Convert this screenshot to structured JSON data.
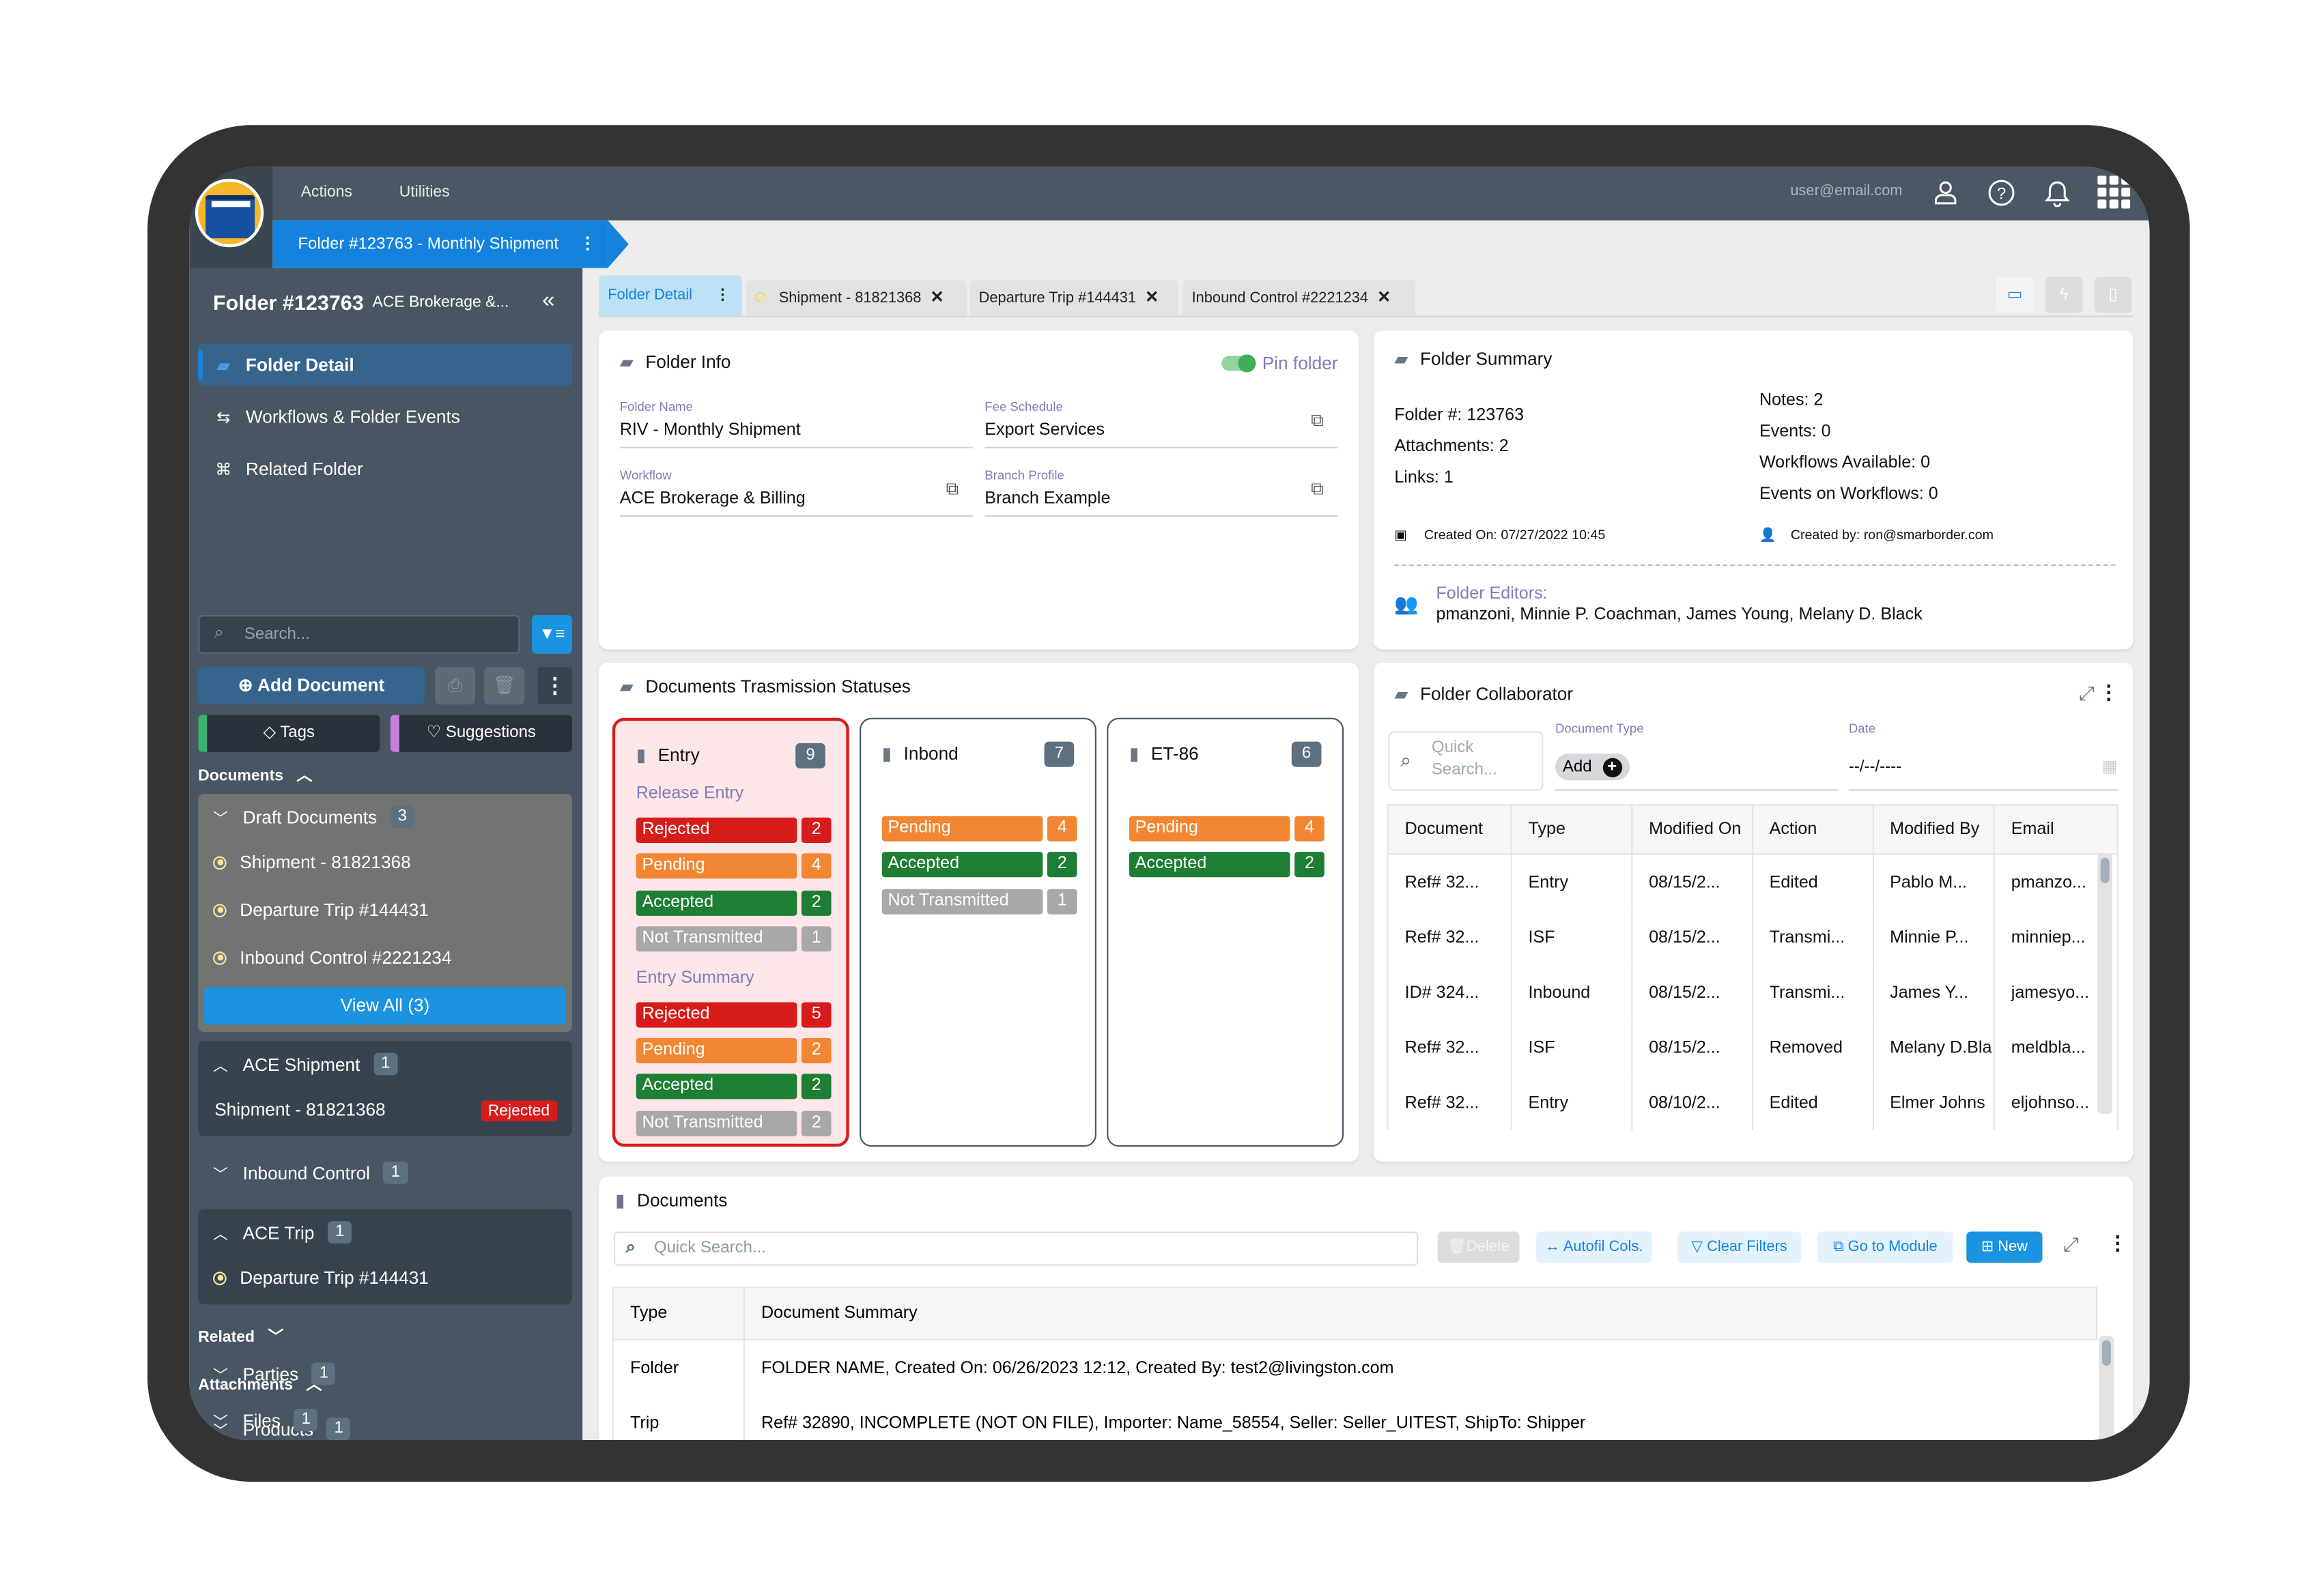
{
  "topbar": {
    "menus": [
      "Actions",
      "Utilities"
    ],
    "user_email": "user@email.com",
    "breadcrumb": "Folder #123763 - Monthly Shipment"
  },
  "sidebar": {
    "title": "Folder #123763",
    "subtitle": "ACE Brokerage &...",
    "nav": [
      {
        "label": "Folder Detail",
        "icon": "folder-open-icon",
        "active": true
      },
      {
        "label": "Workflows & Folder Events",
        "icon": "workflow-icon"
      },
      {
        "label": "Related Folder",
        "icon": "hierarchy-icon"
      }
    ],
    "search_placeholder": "Search...",
    "add_document": "Add Document",
    "tags": "Tags",
    "suggestions": "Suggestions",
    "documents_heading": "Documents",
    "draft": {
      "label": "Draft Documents",
      "count": "3",
      "items": [
        "Shipment - 81821368",
        "Departure Trip #144431",
        "Inbound Control #2221234"
      ],
      "view_all": "View All (3)"
    },
    "ace_shipment": {
      "label": "ACE Shipment",
      "count": "1",
      "item": "Shipment - 81821368",
      "status": "Rejected"
    },
    "inbound_control": {
      "label": "Inbound Control",
      "count": "1"
    },
    "ace_trip": {
      "label": "ACE Trip",
      "count": "1",
      "item": "Departure Trip #144431"
    },
    "related_heading": "Related",
    "parties": {
      "label": "Parties",
      "count": "1"
    },
    "products": {
      "label": "Products",
      "count": "1"
    },
    "attachments_heading": "Attachments",
    "files": {
      "label": "Files",
      "count": "1"
    }
  },
  "tabs": [
    {
      "label": "Folder Detail",
      "active": true
    },
    {
      "label": "Shipment - 81821368"
    },
    {
      "label": "Departure Trip #144431"
    },
    {
      "label": "Inbound Control #2221234"
    }
  ],
  "folder_info": {
    "title": "Folder Info",
    "pin_label": "Pin folder",
    "pin_on": true,
    "fields": [
      {
        "label": "Folder Name",
        "value": "RIV - Monthly Shipment"
      },
      {
        "label": "Fee Schedule",
        "value": "Export Services"
      },
      {
        "label": "Workflow",
        "value": "ACE Brokerage & Billing"
      },
      {
        "label": "Branch Profile",
        "value": "Branch Example"
      }
    ]
  },
  "folder_summary": {
    "title": "Folder Summary",
    "left": [
      "Folder #: 123763",
      "Attachments: 2",
      "Links: 1"
    ],
    "right": [
      "Notes: 2",
      "Events: 0",
      "Workflows Available: 0",
      "Events on Workflows: 0"
    ],
    "created_on": "Created On: 07/27/2022 10:45",
    "created_by": "Created by: ron@smarborder.com",
    "editors_label": "Folder Editors:",
    "editors": "pmanzoni, Minnie P. Coachman, James Young, Melany D. Black"
  },
  "transmission": {
    "title": "Documents Trasmission Statuses",
    "colors": {
      "Rejected": "#d71c1c",
      "Pending": "#f28733",
      "Accepted": "#1e7e34",
      "Not Transmitted": "#a8a8a8"
    },
    "boxes": [
      {
        "name": "Entry",
        "count": "9",
        "groups": [
          {
            "heading": "Release Entry",
            "rows": [
              [
                "Rejected",
                "2"
              ],
              [
                "Pending",
                "4"
              ],
              [
                "Accepted",
                "2"
              ],
              [
                "Not Transmitted",
                "1"
              ]
            ]
          },
          {
            "heading": "Entry Summary",
            "rows": [
              [
                "Rejected",
                "5"
              ],
              [
                "Pending",
                "2"
              ],
              [
                "Accepted",
                "2"
              ],
              [
                "Not Transmitted",
                "2"
              ]
            ]
          }
        ]
      },
      {
        "name": "Inbond",
        "count": "7",
        "groups": [
          {
            "heading": "",
            "rows": [
              [
                "Pending",
                "4"
              ],
              [
                "Accepted",
                "2"
              ],
              [
                "Not Transmitted",
                "1"
              ]
            ]
          }
        ]
      },
      {
        "name": "ET-86",
        "count": "6",
        "groups": [
          {
            "heading": "",
            "rows": [
              [
                "Pending",
                "4"
              ],
              [
                "Accepted",
                "2"
              ]
            ]
          }
        ]
      }
    ]
  },
  "collaborator": {
    "title": "Folder Collaborator",
    "search_placeholder": "Quick Search...",
    "doc_type_label": "Document Type",
    "add_label": "Add",
    "date_label": "Date",
    "date_value": "--/--/----",
    "columns": [
      "Document",
      "Type",
      "Modified On",
      "Action",
      "Modified By",
      "Email"
    ],
    "rows": [
      [
        "Ref# 32...",
        "Entry",
        "08/15/2...",
        "Edited",
        "Pablo M...",
        "pmanzo..."
      ],
      [
        "Ref# 32...",
        "ISF",
        "08/15/2...",
        "Transmi...",
        "Minnie P...",
        "minniep..."
      ],
      [
        "ID# 324...",
        "Inbound",
        "08/15/2...",
        "Transmi...",
        "James Y...",
        "jamesyo..."
      ],
      [
        "Ref# 32...",
        "ISF",
        "08/15/2...",
        "Removed",
        "Melany D.Bla",
        "meldbla..."
      ],
      [
        "Ref# 32...",
        "Entry",
        "08/10/2...",
        "Edited",
        "Elmer Johns",
        "eljohnso..."
      ]
    ]
  },
  "documents": {
    "title": "Documents",
    "search_placeholder": "Quick Search...",
    "buttons": {
      "delete": "Delete",
      "autofit": "Autofil Cols.",
      "clear": "Clear Filters",
      "goto": "Go to Module",
      "new": "New"
    },
    "columns": [
      "Type",
      "Document Summary"
    ],
    "rows": [
      [
        "Folder",
        "FOLDER NAME, Created On: 06/26/2023 12:12, Created By: test2@livingston.com"
      ],
      [
        "Trip",
        "Ref# 32890, INCOMPLETE (NOT ON FILE), Importer: Name_58554, Seller: Seller_UITEST, ShipTo: Shipper"
      ]
    ]
  }
}
